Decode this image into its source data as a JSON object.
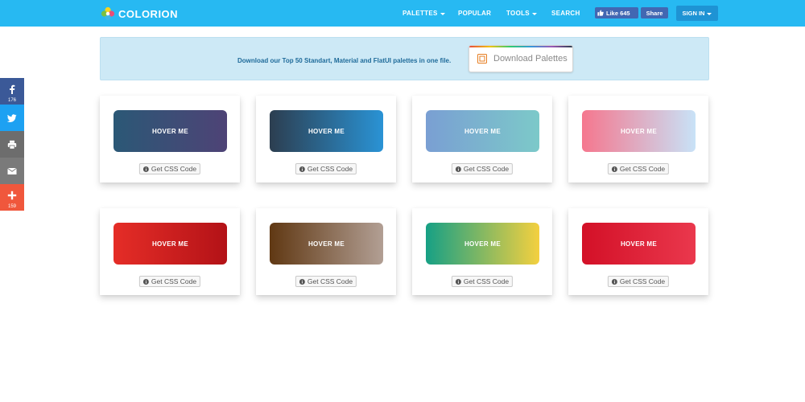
{
  "navbar": {
    "brand": "COLORION",
    "links": {
      "palettes": "PALETTES",
      "popular": "POPULAR",
      "tools": "TOOLS",
      "search": "SEARCH"
    },
    "fb_like": "Like 645",
    "fb_share": "Share",
    "sign_in": "SIGN IN"
  },
  "banner": {
    "text": "Download our Top 50 Standart, Material and FlatUI palettes in one file.",
    "button": "Download Palettes"
  },
  "share": {
    "facebook_count": "176",
    "more_count": "159"
  },
  "cards": [
    {
      "label": "HOVER ME",
      "button": "Get CSS Code",
      "from": "#2b5876",
      "to": "#4e4376"
    },
    {
      "label": "HOVER ME",
      "button": "Get CSS Code",
      "from": "#2c3e50",
      "to": "#2a93d5"
    },
    {
      "label": "HOVER ME",
      "button": "Get CSS Code",
      "from": "#7a9fd3",
      "to": "#7cc9c9"
    },
    {
      "label": "HOVER ME",
      "button": "Get CSS Code",
      "from": "#f5778e",
      "to": "#c8e2f7"
    },
    {
      "label": "HOVER ME",
      "button": "Get CSS Code",
      "from": "#e52d27",
      "to": "#b31217"
    },
    {
      "label": "HOVER ME",
      "button": "Get CSS Code",
      "from": "#603813",
      "to": "#b29f94"
    },
    {
      "label": "HOVER ME",
      "button": "Get CSS Code",
      "from": "#16a085",
      "to": "#f4d03f"
    },
    {
      "label": "HOVER ME",
      "button": "Get CSS Code",
      "from": "#d31027",
      "to": "#ea384d"
    }
  ],
  "colors": {
    "navbar": "#27b9f2",
    "banner": "#cde9f6",
    "facebook": "#3b5998",
    "twitter": "#1da1f2",
    "print": "#6d6d6d",
    "email": "#7a7a7a",
    "more": "#f0573c"
  },
  "icons": {
    "brand": "colorion-logo-icon",
    "facebook": "facebook-icon",
    "twitter": "twitter-icon",
    "print": "print-icon",
    "email": "email-icon",
    "more": "plus-icon",
    "download": "palette-download-icon",
    "info": "info-icon"
  }
}
